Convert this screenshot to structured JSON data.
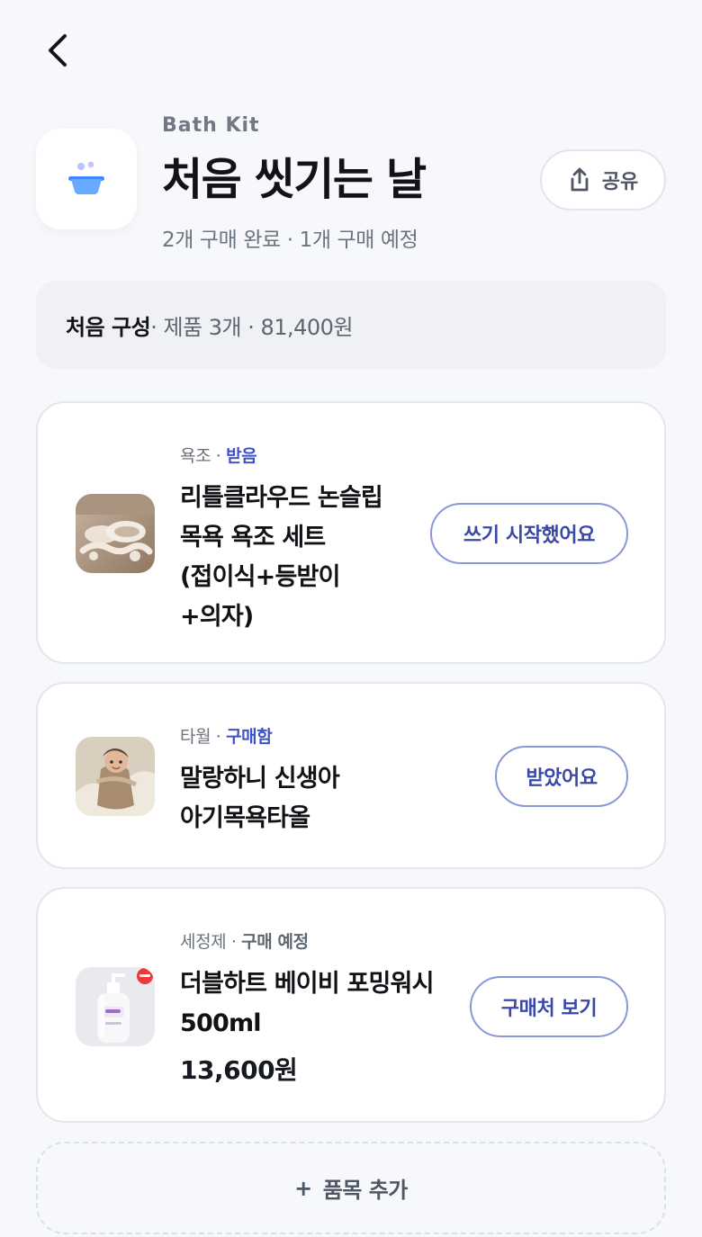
{
  "header": {
    "kit_label": "Bath Kit",
    "title": "처음 씻기는 날",
    "status": "2개 구매 완료 · 1개 구매 예정",
    "share_label": "공유"
  },
  "summary": {
    "composition": "처음 구성",
    "details": " · 제품 3개 · 81,400원"
  },
  "items": [
    {
      "category": "욕조",
      "status": "받음",
      "name": "리틀클라우드 논슬립\n목욕 욕조 세트\n(접이식+등받이\n+의자)",
      "action": "쓰기 시작했어요"
    },
    {
      "category": "타월",
      "status": "구매함",
      "name": "말랑하니 신생아\n아기목욕타올",
      "action": "받았어요"
    },
    {
      "category": "세정제",
      "status": "구매 예정",
      "name": "더블하트 베이비 포밍워시\n500ml",
      "price": "13,600원",
      "action": "구매처 보기"
    }
  ],
  "add_item_label": "품목 추가",
  "colors": {
    "background": "#f7f8fb",
    "accent": "#3f53c8",
    "card_border": "#e3e6eb"
  },
  "icons": {
    "back": "back-arrow-icon",
    "kit": "bathtub-icon",
    "share": "share-icon",
    "add": "plus-icon"
  }
}
